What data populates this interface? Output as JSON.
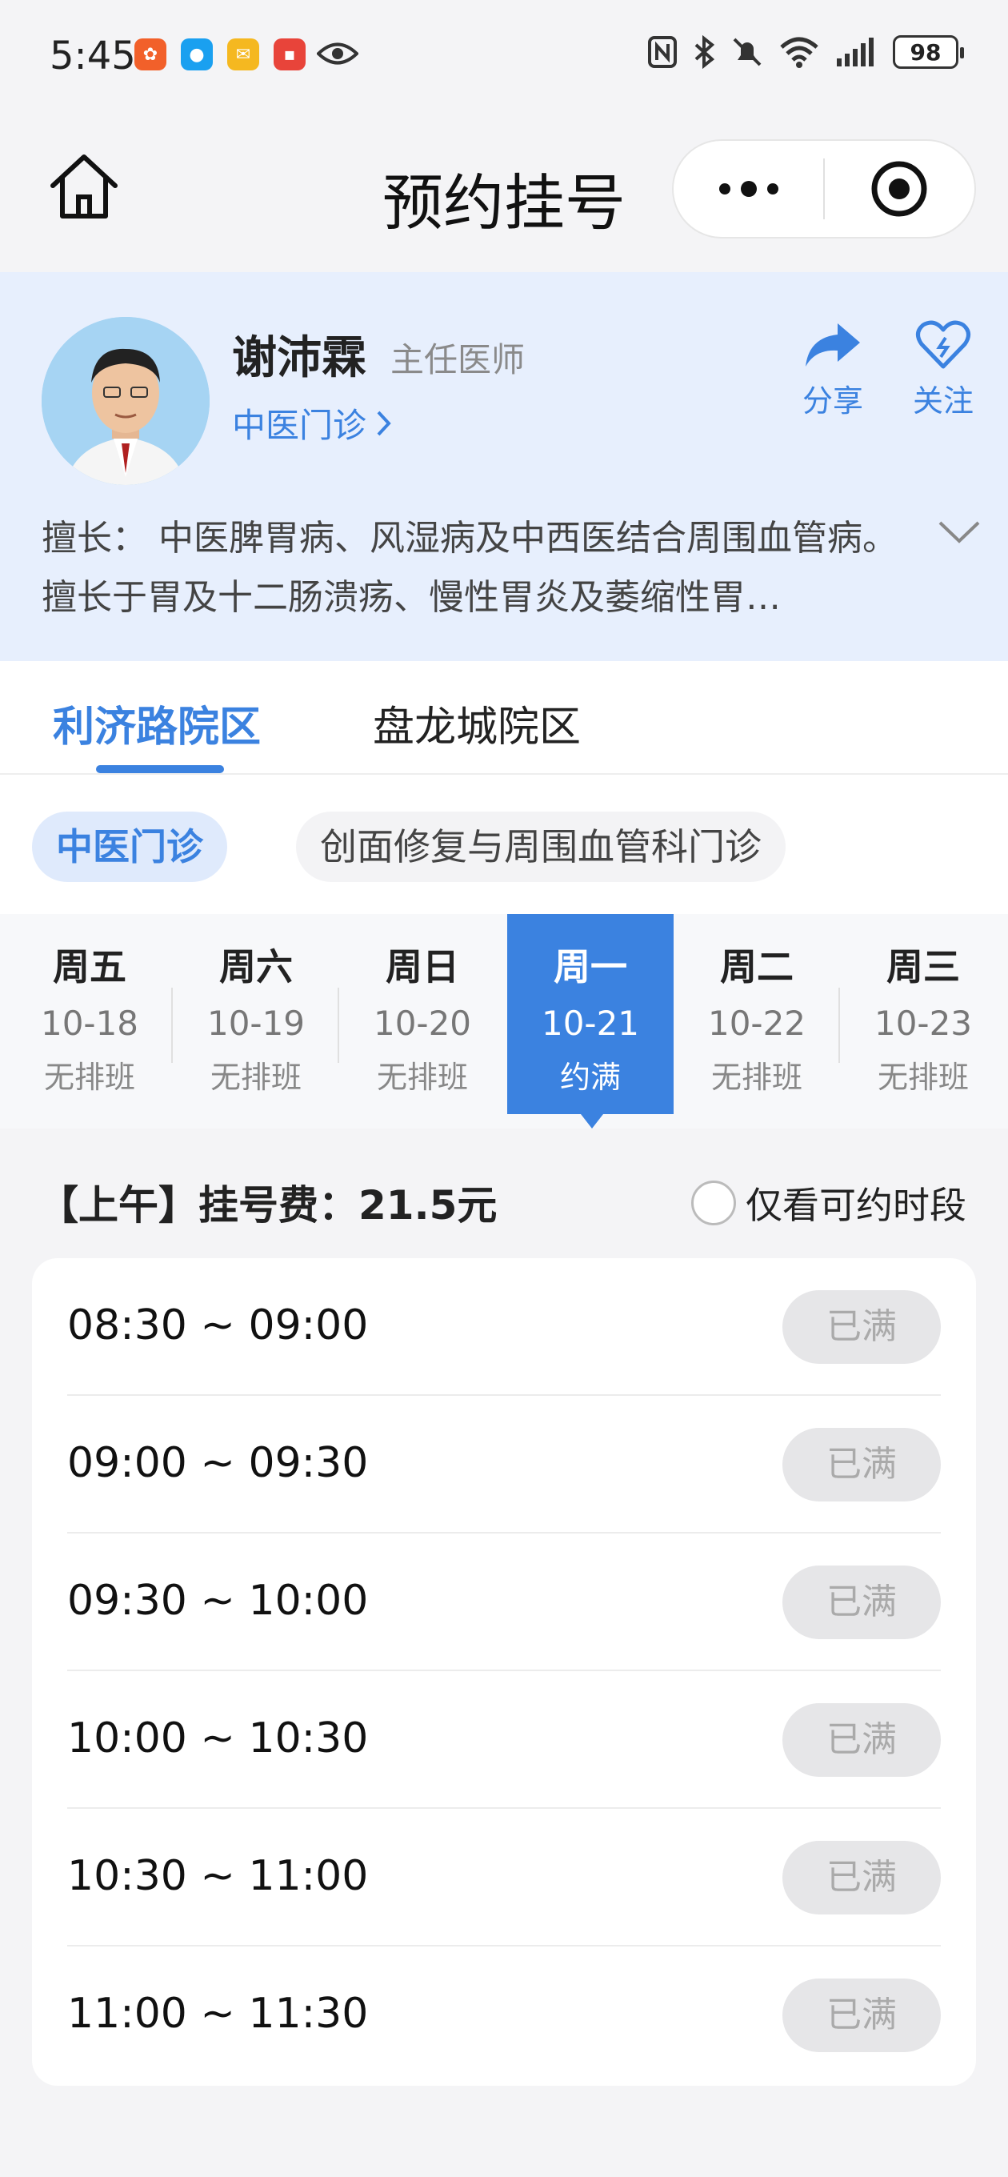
{
  "status_bar": {
    "time": "5:45",
    "battery": "98",
    "icons": [
      "nfc-icon",
      "bluetooth-icon",
      "mute-icon",
      "wifi-icon",
      "signal-icon",
      "battery-icon"
    ]
  },
  "nav": {
    "title": "预约挂号"
  },
  "doctor": {
    "name": "谢沛霖",
    "title": "主任医师",
    "dept": "中医门诊",
    "share_label": "分享",
    "follow_label": "关注",
    "skill": "擅长： 中医脾胃病、风湿病及中西医结合周围血管病。擅长于胃及十二肠溃疡、慢性胃炎及萎缩性胃…"
  },
  "hospital_tabs": [
    {
      "label": "利济路院区",
      "active": true
    },
    {
      "label": "盘龙城院区",
      "active": false
    }
  ],
  "dept_chips": [
    {
      "label": "中医门诊",
      "active": true
    },
    {
      "label": "创面修复与周围血管科门诊",
      "active": false
    }
  ],
  "days": [
    {
      "week": "周五",
      "date": "10-18",
      "status": "无排班"
    },
    {
      "week": "周六",
      "date": "10-19",
      "status": "无排班"
    },
    {
      "week": "周日",
      "date": "10-20",
      "status": "无排班"
    },
    {
      "week": "周一",
      "date": "10-21",
      "status": "约满"
    },
    {
      "week": "周二",
      "date": "10-22",
      "status": "无排班"
    },
    {
      "week": "周三",
      "date": "10-23",
      "status": "无排班"
    }
  ],
  "session": {
    "fee_text": "【上午】挂号费：21.5元",
    "filter_label": "仅看可约时段"
  },
  "slots": [
    {
      "time": "08:30 ~ 09:00",
      "status": "已满"
    },
    {
      "time": "09:00 ~ 09:30",
      "status": "已满"
    },
    {
      "time": "09:30 ~ 10:00",
      "status": "已满"
    },
    {
      "time": "10:00 ~ 10:30",
      "status": "已满"
    },
    {
      "time": "10:30 ~ 11:00",
      "status": "已满"
    },
    {
      "time": "11:00 ~ 11:30",
      "status": "已满"
    }
  ],
  "colors": {
    "accent": "#3b82e0",
    "header_bg": "#e7effd",
    "page_bg": "#f4f4f6"
  }
}
